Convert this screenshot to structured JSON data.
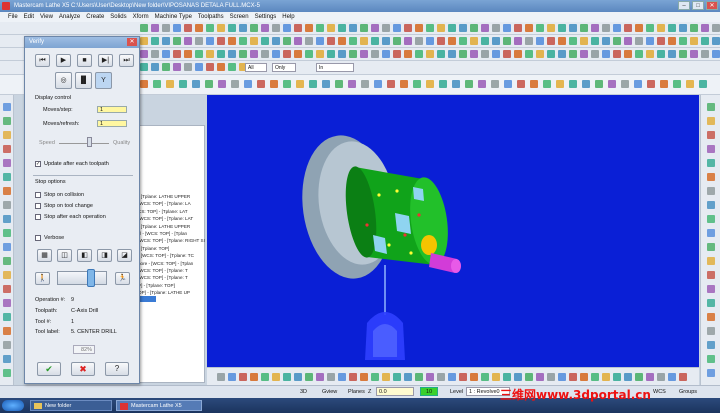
{
  "window": {
    "title": "Mastercam Lathe X5  C:\\Users\\User\\Desktop\\New folder\\VIPOSANAS DETALA FULL.MCX-5"
  },
  "menubar": [
    "File",
    "Edit",
    "View",
    "Analyze",
    "Create",
    "Solids",
    "Xform",
    "Machine Type",
    "Toolpaths",
    "Screen",
    "Settings",
    "Help"
  ],
  "toolbar": {
    "field_all": "All",
    "field_only": "Only",
    "field_in": "In"
  },
  "verify": {
    "title": "Verify",
    "display_control": "Display control",
    "moves_step_label": "Moves/step:",
    "moves_step_value": "1",
    "moves_refresh_label": "Moves/refresh:",
    "moves_refresh_value": "1",
    "speed_label": "Speed",
    "quality_label": "Quality",
    "update_label": "Update after each toolpath",
    "stop_options": "Stop options",
    "stop_collision": "Stop on collision",
    "stop_tool_change": "Stop on tool change",
    "stop_after_op": "Stop after each operation",
    "verbose": "Verbose",
    "operation_label": "Operation #:",
    "operation_value": "9",
    "toolpath_label": "Toolpath:",
    "toolpath_value": "C-Axis Drill",
    "tool_num_label": "Tool #:",
    "tool_num_value": "1",
    "tool_label_label": "Tool label:",
    "tool_label_value": "5. CENTER DRILL",
    "progress": "82%"
  },
  "ops_list": [
    "- [Tplane: LATHE UPPER",
    "[WCS: TOP] - [Tplane: LA",
    "CS: TOP] - [Tplane: LAT",
    "[WCS: TOP] - [Tplane: LAT",
    "- [Tplane: LATHE UPPER",
    "ill - [WCS: TOP] - [Tplan",
    "[WCS: TOP] - [Tplane: RIGHT SI",
    "- [Tplane: TOP]",
    "- [WCS: TOP] - [Tplane: TC",
    "hore - [WCS: TOP] - [Tplan",
    "[WCS: TOP] - [Tplane: T",
    "[WCS: TOP] - [Tplane: T",
    "P] - [Tplane: TOP]",
    "OP] - [Tplane: LATHE UP"
  ],
  "statusbar": {
    "mode": "3D",
    "gview": "Gview",
    "planes": "Planes",
    "z_label": "Z",
    "z_value": "0.0",
    "level_value": "10",
    "level_label": "Level",
    "level_name": "1 : Revolve0",
    "wcs": "WCS",
    "groups": "Groups"
  },
  "taskbar": {
    "item1": "New folder",
    "item2": "Mastercam Lathe X5"
  },
  "watermark": "三维网www.3dportal.cn"
}
